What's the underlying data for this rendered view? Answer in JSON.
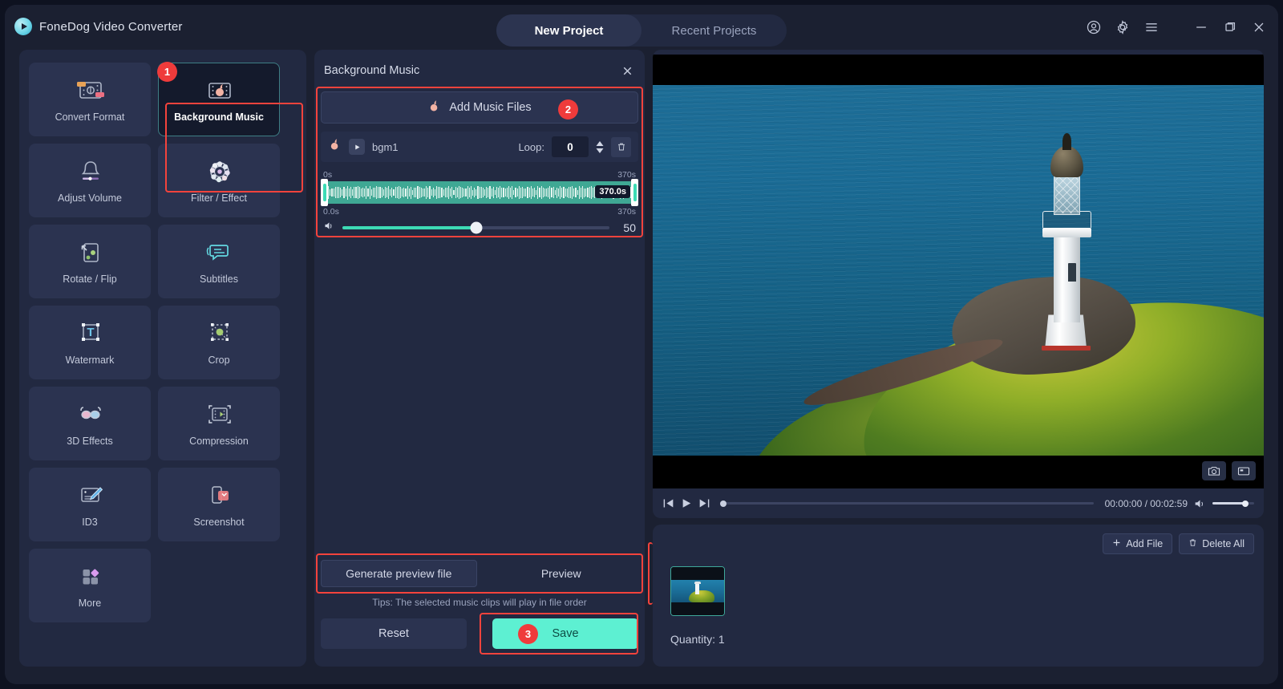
{
  "app": {
    "brand": "FoneDog Video Converter",
    "logo_icon": "play-circle-icon"
  },
  "header": {
    "tabs": [
      {
        "label": "New Project",
        "active": true
      },
      {
        "label": "Recent Projects",
        "active": false
      }
    ],
    "window_icons": [
      "account-icon",
      "gear-icon",
      "menu-icon",
      "minimize-icon",
      "maximize-icon",
      "close-icon"
    ]
  },
  "sidebar": {
    "tools": [
      {
        "label": "Convert Format",
        "icon": "convert-format-icon",
        "selected": false
      },
      {
        "label": "Background Music",
        "icon": "background-music-icon",
        "selected": true,
        "badge": "1"
      },
      {
        "label": "Adjust Volume",
        "icon": "adjust-volume-icon",
        "selected": false
      },
      {
        "label": "Filter / Effect",
        "icon": "filter-effect-icon",
        "selected": false
      },
      {
        "label": "Rotate / Flip",
        "icon": "rotate-flip-icon",
        "selected": false
      },
      {
        "label": "Subtitles",
        "icon": "subtitles-icon",
        "selected": false
      },
      {
        "label": "Watermark",
        "icon": "watermark-icon",
        "selected": false
      },
      {
        "label": "Crop",
        "icon": "crop-icon",
        "selected": false
      },
      {
        "label": "3D Effects",
        "icon": "3d-effects-icon",
        "selected": false
      },
      {
        "label": "Compression",
        "icon": "compression-icon",
        "selected": false
      },
      {
        "label": "ID3",
        "icon": "id3-icon",
        "selected": false
      },
      {
        "label": "Screenshot",
        "icon": "screenshot-icon",
        "selected": false
      },
      {
        "label": "More",
        "icon": "more-icon",
        "selected": false
      }
    ]
  },
  "music_panel": {
    "title": "Background Music",
    "close_icon": "close-icon",
    "add_button": {
      "label": "Add Music Files",
      "icon": "music-note-icon",
      "badge": "2"
    },
    "track": {
      "name": "bgm1",
      "icon": "music-note-icon",
      "play_icon": "play-icon",
      "loop_label": "Loop:",
      "loop_value": "0",
      "delete_icon": "trash-icon"
    },
    "trim": {
      "start_tick": "0s",
      "end_tick": "370s",
      "tooltip": "370.0s",
      "start_value": "0.0s",
      "end_value": "370s"
    },
    "volume": {
      "icon": "speaker-icon",
      "value": "50",
      "percent": 50
    },
    "generate_preview_label": "Generate preview file",
    "preview_label": "Preview",
    "tips": "Tips: The selected music clips will play in file order",
    "reset_label": "Reset",
    "save_label": "Save",
    "save_badge": "3"
  },
  "preview": {
    "screenshot_icon": "camera-icon",
    "fullscreen_icon": "fullscreen-icon",
    "controls": {
      "prev_icon": "skip-prev-icon",
      "play_icon": "play-icon",
      "next_icon": "skip-next-icon",
      "time": "00:00:00 / 00:02:59",
      "volume_icon": "speaker-icon"
    }
  },
  "files": {
    "add_file_label": "Add File",
    "add_file_icon": "plus-icon",
    "delete_all_label": "Delete All",
    "delete_all_icon": "trash-icon",
    "quantity": "Quantity: 1"
  },
  "colors": {
    "accent_teal": "#5df0d2",
    "highlight_red": "#f4433c",
    "badge_red": "#ef3b3b",
    "panel_bg": "#222941",
    "tile_bg": "#2b3350"
  }
}
